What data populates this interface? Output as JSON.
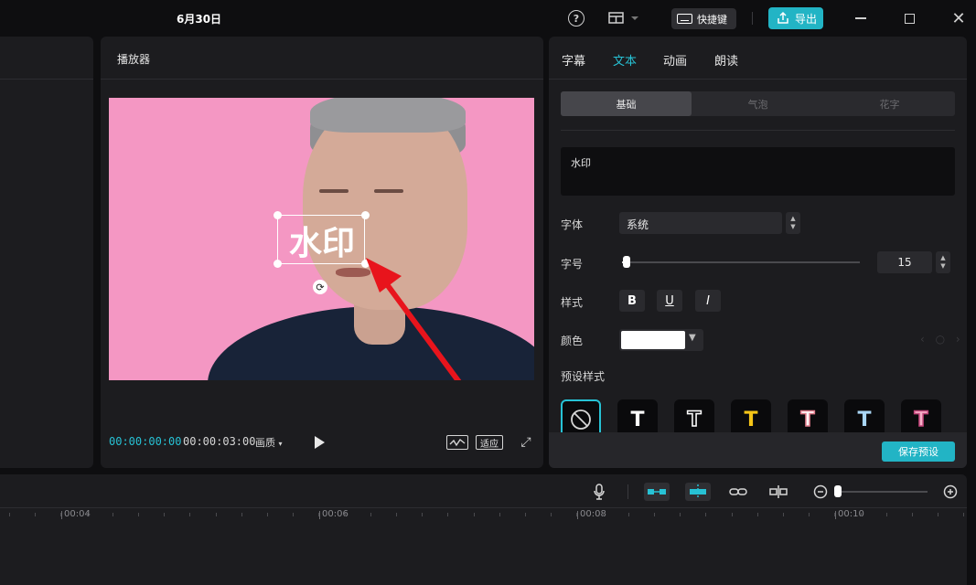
{
  "window": {
    "title": "6月30日",
    "help_icon": "help-icon",
    "layout_icon": "layout-icon",
    "shortcut_label": "快捷键",
    "export_label": "导出",
    "minimize_icon": "minimize-icon",
    "maximize_icon": "maximize-icon",
    "close_icon": "close-icon"
  },
  "player": {
    "title": "播放器",
    "watermark_text": "水印",
    "current_time": "00:00:00:00",
    "total_time": "00:00:03:00",
    "quality_label": "画质",
    "fit_label": "适应"
  },
  "inspector": {
    "tabs": [
      "字幕",
      "文本",
      "动画",
      "朗读"
    ],
    "active_tab": "文本",
    "subtabs": [
      "基础",
      "气泡",
      "花字"
    ],
    "active_subtab": "基础",
    "text_value": "水印",
    "font_label": "字体",
    "font_value": "系统",
    "size_label": "字号",
    "size_value": "15",
    "style_label": "样式",
    "style_buttons": [
      "B",
      "U",
      "I"
    ],
    "color_label": "颜色",
    "color_value": "#ffffff",
    "preset_label": "预设样式",
    "presets": [
      {
        "glyph": "⃠",
        "color": "#d6d6d6"
      },
      {
        "glyph": "T",
        "color": "#ffffff"
      },
      {
        "glyph": "T",
        "color": "#0a0a0c",
        "outline": "#ffffff"
      },
      {
        "glyph": "T",
        "color": "#f5c518"
      },
      {
        "glyph": "T",
        "color": "#ffffff",
        "outline": "#e07a8a"
      },
      {
        "glyph": "T",
        "color": "#a9d6f5"
      },
      {
        "glyph": "T",
        "color": "#f7b0c8",
        "outline": "#c2457a"
      }
    ],
    "save_preset_label": "保存预设"
  },
  "timeline": {
    "ruler_labels": [
      "00:04",
      "00:06",
      "00:08",
      "00:10"
    ]
  },
  "accent_color": "#22b4c5"
}
